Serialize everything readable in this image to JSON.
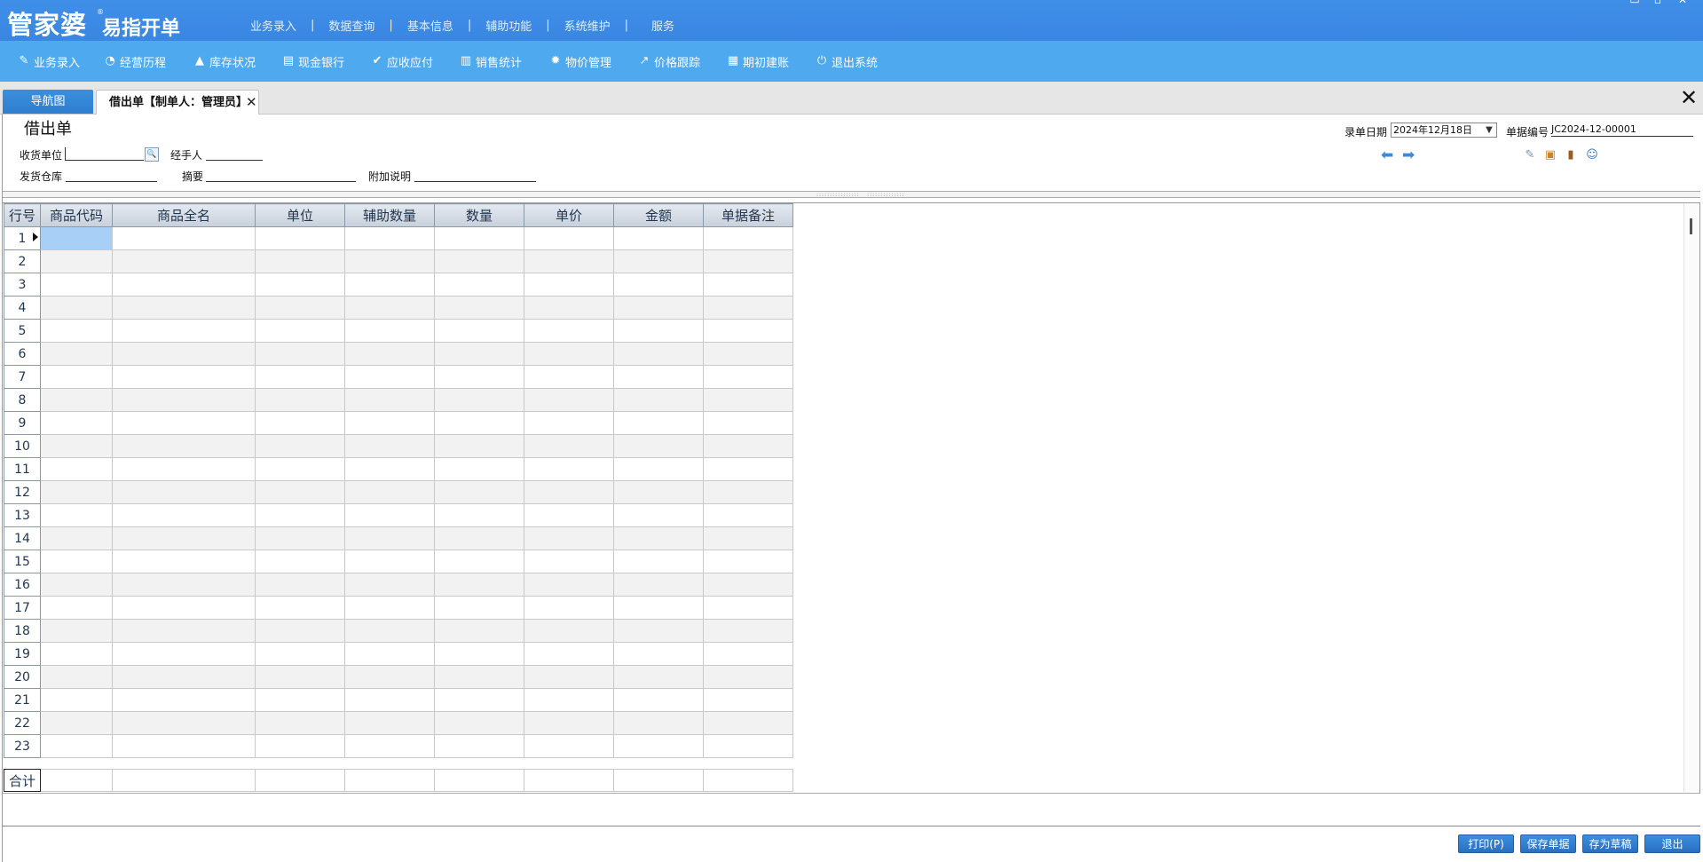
{
  "app": {
    "logo_main": "管家婆",
    "logo_reg": "®",
    "logo_sub": "易指开单",
    "top_menu": [
      "业务录入",
      "数据查询",
      "基本信息",
      "辅助功能",
      "系统维护",
      "服务"
    ],
    "top_menu_sep": "|",
    "window_controls": [
      "▭",
      "▫",
      "✕"
    ]
  },
  "toolbar": [
    {
      "label": "业务录入",
      "icon": "pen-icon",
      "glyph": "✎"
    },
    {
      "label": "经营历程",
      "icon": "clock-pie-icon",
      "glyph": "◔"
    },
    {
      "label": "库存状况",
      "icon": "house-icon",
      "glyph": "▲"
    },
    {
      "label": "现金银行",
      "icon": "book-icon",
      "glyph": "▤"
    },
    {
      "label": "应收应付",
      "icon": "check-circle-icon",
      "glyph": "✔"
    },
    {
      "label": "销售统计",
      "icon": "bar-chart-icon",
      "glyph": "▥"
    },
    {
      "label": "物价管理",
      "icon": "gear-icon",
      "glyph": "✹"
    },
    {
      "label": "价格跟踪",
      "icon": "arrow-up-right-icon",
      "glyph": "↗"
    },
    {
      "label": "期初建账",
      "icon": "grid-calendar-icon",
      "glyph": "▦"
    },
    {
      "label": "退出系统",
      "icon": "power-icon",
      "glyph": "⏻"
    }
  ],
  "tabs": {
    "nav": "导航图",
    "doc": "借出单【制单人：管理员】",
    "close": "✕"
  },
  "form": {
    "title": "借出单",
    "receiver_label": "收货单位",
    "receiver_value": "",
    "handler_label": "经手人",
    "handler_value": "",
    "warehouse_label": "发货仓库",
    "warehouse_value": "",
    "summary_label": "摘要",
    "summary_value": "",
    "note_label": "附加说明",
    "note_value": "",
    "date_label": "录单日期",
    "date_value": "2024年12月18日",
    "docno_label": "单据编号",
    "docno_value": "JC2024-12-00001",
    "search_glyph": "🔍",
    "arrow_left": "⬅",
    "arrow_right": "➡",
    "right_icons": [
      "edit-icon",
      "package-icon",
      "book-icon",
      "user-icon"
    ]
  },
  "grid": {
    "columns": [
      "行号",
      "商品代码",
      "商品全名",
      "单位",
      "辅助数量",
      "数量",
      "单价",
      "金额",
      "单据备注"
    ],
    "row_numbers": [
      "1",
      "2",
      "3",
      "4",
      "5",
      "6",
      "7",
      "8",
      "9",
      "10",
      "11",
      "12",
      "13",
      "14",
      "15",
      "16",
      "17",
      "18",
      "19",
      "20",
      "21",
      "22",
      "23"
    ],
    "total_label": "合计"
  },
  "buttons": {
    "print": "打印(P)",
    "save": "保存单据",
    "draft": "存为草稿",
    "exit": "退出"
  },
  "colors": {
    "title_bar": "#3a86e2",
    "toolbar": "#4ea9ee",
    "selected_cell": "#a8d0f7",
    "button": "#2b6fbf"
  }
}
